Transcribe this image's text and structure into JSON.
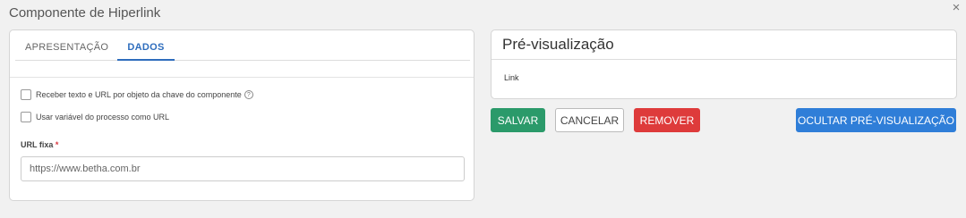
{
  "dialog": {
    "title": "Componente de Hiperlink",
    "close_symbol": "×"
  },
  "tabs": [
    {
      "label": "APRESENTAÇÃO",
      "active": false
    },
    {
      "label": "DADOS",
      "active": true
    }
  ],
  "form": {
    "checkbox_chave": {
      "label": "Receber texto e URL por objeto da chave do componente",
      "checked": false,
      "help_symbol": "?"
    },
    "checkbox_variavel": {
      "label": "Usar variável do processo como URL",
      "checked": false
    },
    "url_label": "URL fixa",
    "required_mark": "*",
    "url_value": "https://www.betha.com.br"
  },
  "preview": {
    "title": "Pré-visualização",
    "link_text": "Link"
  },
  "actions": {
    "save_label": "SALVAR",
    "cancel_label": "CANCELAR",
    "remove_label": "REMOVER",
    "hide_preview_label": "OCULTAR PRÉ-VISUALIZAÇÃO"
  },
  "colors": {
    "primary": "#2f7ed8",
    "success": "#2b9a6a",
    "danger": "#de3b3b",
    "active_tab": "#2e6dbd"
  },
  "icons": [
    "close-icon",
    "help-icon"
  ]
}
